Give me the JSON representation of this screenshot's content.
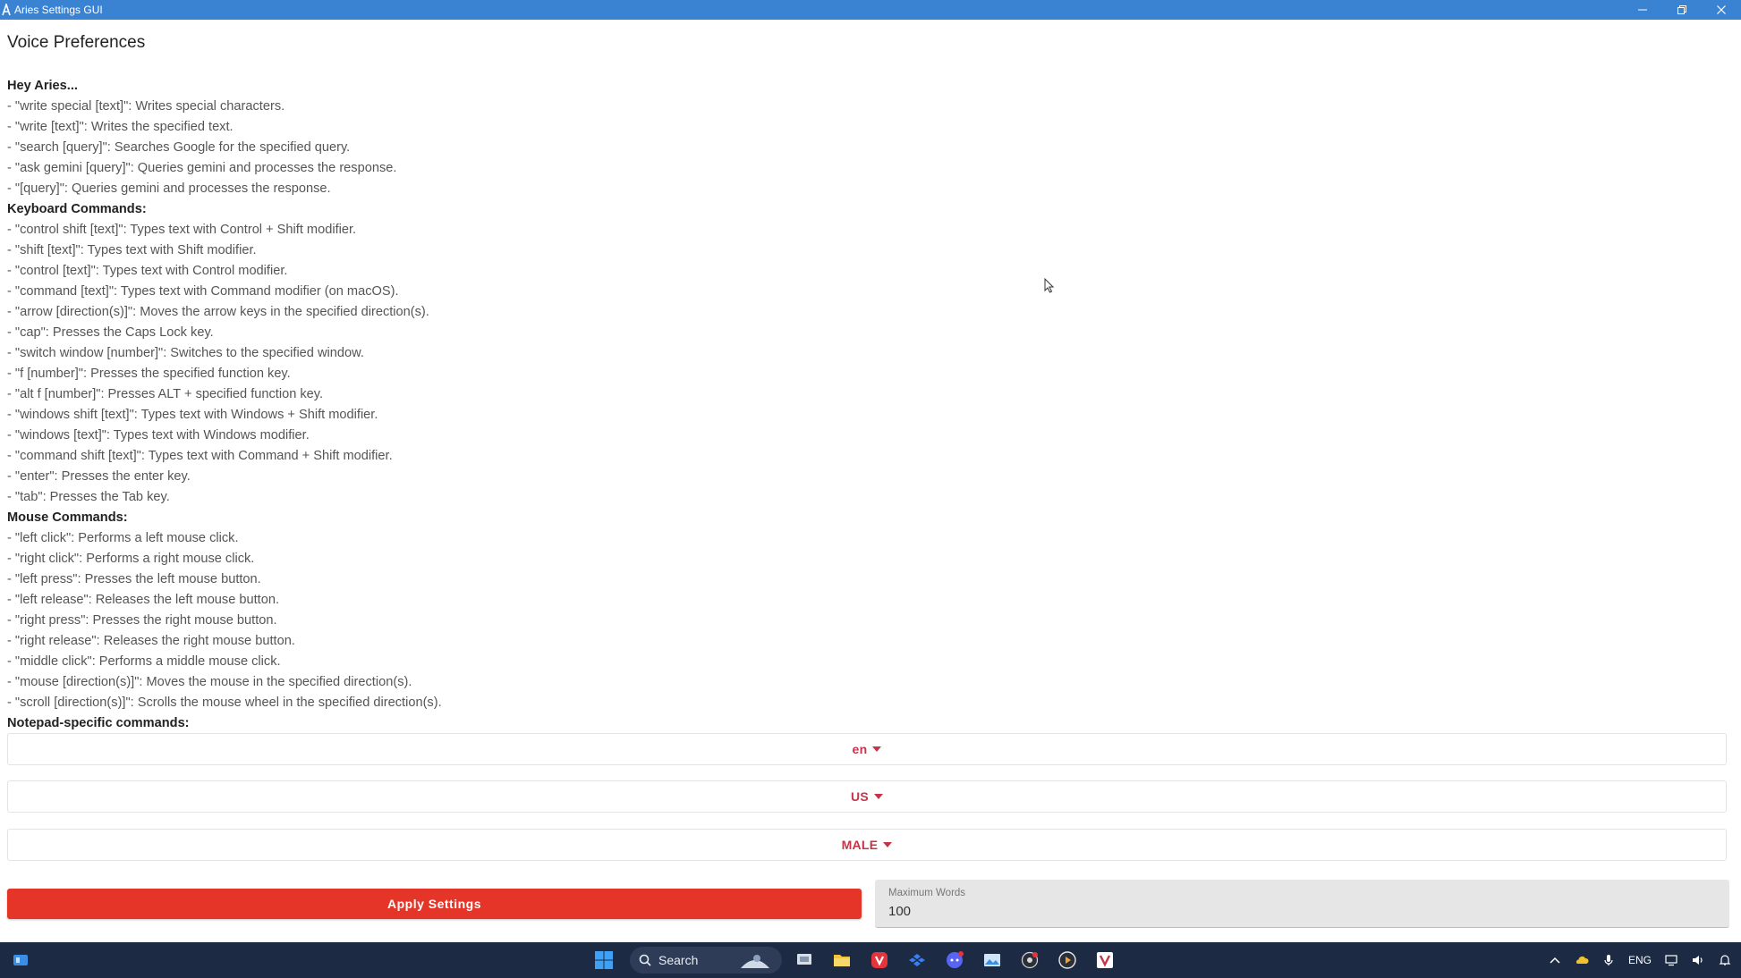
{
  "window": {
    "title": "Aries Settings GUI"
  },
  "page": {
    "title": "Voice Preferences"
  },
  "help": {
    "sections": [
      {
        "heading": "Hey Aries...",
        "lines": [
          "- \"write special [text]\": Writes special characters.",
          "- \"write [text]\": Writes the specified text.",
          "- \"search [query]\": Searches Google for the specified query.",
          "- \"ask gemini [query]\": Queries gemini and processes the response.",
          "- \"[query]\": Queries gemini and processes the response."
        ]
      },
      {
        "heading": "Keyboard Commands:",
        "lines": [
          "- \"control shift [text]\": Types text with Control + Shift modifier.",
          "- \"shift [text]\": Types text with Shift modifier.",
          "- \"control [text]\": Types text with Control modifier.",
          "- \"command [text]\": Types text with Command modifier (on macOS).",
          "- \"arrow [direction(s)]\": Moves the arrow keys in the specified direction(s).",
          "- \"cap\": Presses the Caps Lock key.",
          "- \"switch window [number]\": Switches to the specified window.",
          "- \"f [number]\": Presses the specified function key.",
          "- \"alt f [number]\": Presses ALT + specified function key.",
          "- \"windows shift [text]\": Types text with Windows + Shift modifier.",
          "- \"windows [text]\": Types text with Windows modifier.",
          "- \"command shift [text]\": Types text with Command + Shift modifier.",
          "- \"enter\": Presses the enter key.",
          "- \"tab\": Presses the Tab key."
        ]
      },
      {
        "heading": "Mouse Commands:",
        "lines": [
          "- \"left click\": Performs a left mouse click.",
          "- \"right click\": Performs a right mouse click.",
          "- \"left press\": Presses the left mouse button.",
          "- \"left release\": Releases the left mouse button.",
          "- \"right press\": Presses the right mouse button.",
          "- \"right release\": Releases the right mouse button.",
          "- \"middle click\": Performs a middle mouse click.",
          "- \"mouse [direction(s)]\": Moves the mouse in the specified direction(s).",
          "- \"scroll [direction(s)]\": Scrolls the mouse wheel in the specified direction(s)."
        ]
      },
      {
        "heading": "Notepad-specific commands:",
        "lines": []
      }
    ]
  },
  "settings": {
    "language": "en",
    "region": "US",
    "gender": "MALE",
    "apply_label": "Apply Settings",
    "max_words_label": "Maximum Words",
    "max_words_value": "100"
  },
  "taskbar": {
    "search_label": "Search",
    "language": "ENG"
  },
  "colors": {
    "titlebar": "#3a83d3",
    "accent_text": "#c6344a",
    "apply_button": "#e53528",
    "taskbar": "#1c2a44"
  }
}
